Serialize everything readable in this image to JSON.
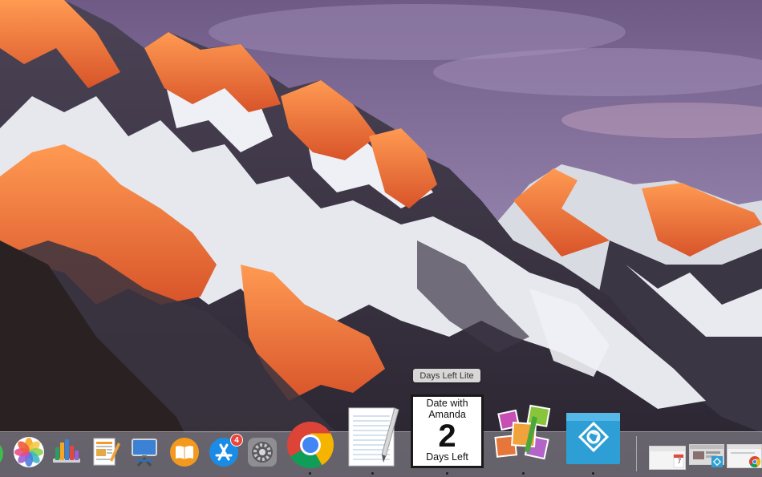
{
  "desktop": {
    "wallpaper_name": "mountain-wallpaper"
  },
  "tooltip": {
    "text": "Days Left Lite"
  },
  "dock": {
    "apps": [
      {
        "name": "Photos",
        "icon": "photos-icon",
        "running": false
      },
      {
        "name": "Numbers",
        "icon": "numbers-icon",
        "running": false
      },
      {
        "name": "Pages",
        "icon": "pages-icon",
        "running": false
      },
      {
        "name": "Keynote",
        "icon": "keynote-icon",
        "running": false
      },
      {
        "name": "iBooks",
        "icon": "ibooks-icon",
        "running": false
      },
      {
        "name": "App Store",
        "icon": "app-store-icon",
        "running": false
      },
      {
        "name": "System Preferences",
        "icon": "system-preferences-icon",
        "running": false
      },
      {
        "name": "Google Chrome",
        "icon": "chrome-icon",
        "running": true
      },
      {
        "name": "TextEdit",
        "icon": "textedit-icon",
        "running": true
      },
      {
        "name": "Days Left Lite",
        "icon": "days-left-widget",
        "running": true
      },
      {
        "name": "Photo Collage",
        "icon": "photo-collage-icon",
        "running": true
      },
      {
        "name": "Camera App",
        "icon": "aperture-icon",
        "running": true
      }
    ],
    "app_store_badge": "4",
    "days_left_widget": {
      "title": "Date with Amanda",
      "number": "2",
      "subtitle": "Days Left"
    },
    "minimized_calendar_day": "7"
  },
  "colors": {
    "dock_bg": "#c8c8cd",
    "badge": "#e9453b",
    "aperture_blue": "#2e9fd4"
  }
}
